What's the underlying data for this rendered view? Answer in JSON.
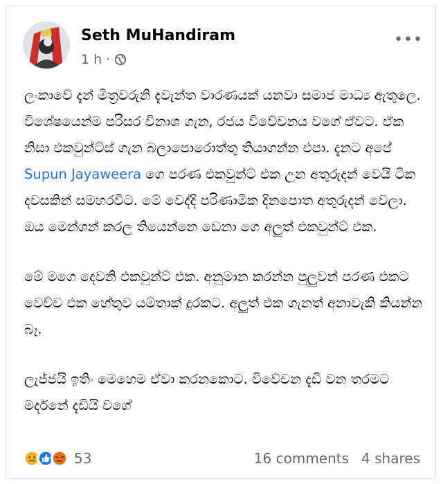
{
  "post": {
    "author": "Seth MuHandiram",
    "time": "1 h",
    "separator": "·",
    "more": "•••",
    "paragraphs": [
      {
        "before": "ලංකාවේ දැන් මිත්‍රවරුනි දැවැන්ත වාරණයක් යනවා සමාජ මාධ්‍ය ඇතුලෙ. විශේෂයෙන්ම පරිසර විනාශ ගැන, රජය විවේචනය වගේ ඒවට. ඒක නිසා එකවුන්ට්ස් ගැන බලාපොරොත්තු තියාගන්න එපා. දැනට අපේ ",
        "mention": "Supun Jayaweera",
        "after": " ගෙ පරණ එකවුන්ට් එක උන අතුරුදන් වෙයි ටික දවසකින් සමහරවිට. මේ වෙද්දි පරිණාමික දිනපොත අතුරුදන් වෙලා. ඔය මෙන්ශන් කරල තියෙන්නෙ ඩෙනා ගෙ අලුත් එකවුන්ට් එක."
      },
      {
        "text": "මේ මගෙ දෙවනි එකවුන්ට් එක. අනුමාන කරන්න පුලුවන් පරණ එකට වෙච්ච එක හේතුව යම්තාක් දුරකට. අලුත් එක ගැනත් අනාවැකි කියන්න බෑ."
      },
      {
        "text": "ලැජ්ජයි ඉතිං මෙහෙම ඒවා කරනකොට. විවේචන දැඩි වන තරමට මර්දනේ දැඩියි වගේ"
      }
    ],
    "reactions": {
      "icons": [
        "sad-icon",
        "like-icon",
        "angry-icon"
      ],
      "count": "53"
    },
    "comments": "16 comments",
    "shares": "4 shares"
  }
}
